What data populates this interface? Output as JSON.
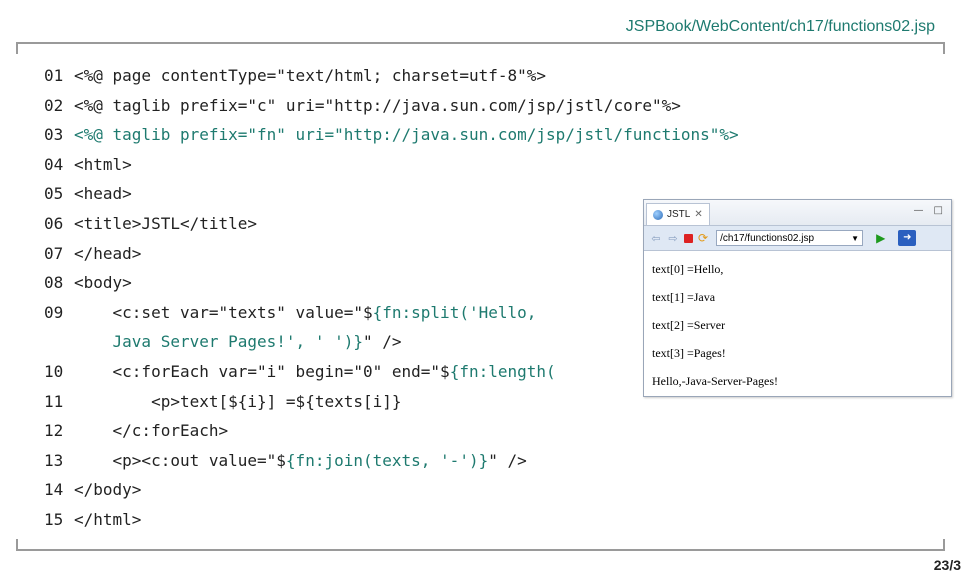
{
  "header": {
    "file_path": "JSPBook/WebContent/ch17/functions02.jsp"
  },
  "code_lines": [
    {
      "num": "01",
      "parts": [
        {
          "text": "<%@ page contentType=\"text/html; charset=utf-8\"%>",
          "teal": false
        }
      ]
    },
    {
      "num": "02",
      "parts": [
        {
          "text": "<%@ taglib prefix=\"c\" uri=\"http://java.sun.com/jsp/jstl/core\"%>",
          "teal": false
        }
      ]
    },
    {
      "num": "03",
      "parts": [
        {
          "text": "<%@ taglib prefix=\"fn\" uri=\"http://java.sun.com/jsp/jstl/functions\"%>",
          "teal": true
        }
      ]
    },
    {
      "num": "04",
      "parts": [
        {
          "text": "<html>",
          "teal": false
        }
      ]
    },
    {
      "num": "05",
      "parts": [
        {
          "text": "<head>",
          "teal": false
        }
      ]
    },
    {
      "num": "06",
      "parts": [
        {
          "text": "<title>JSTL</title>",
          "teal": false
        }
      ]
    },
    {
      "num": "07",
      "parts": [
        {
          "text": "</head>",
          "teal": false
        }
      ]
    },
    {
      "num": "08",
      "parts": [
        {
          "text": "<body>",
          "teal": false
        }
      ]
    },
    {
      "num": "09",
      "parts": [
        {
          "text": "    <c:set var=\"texts\" value=\"$",
          "teal": false
        },
        {
          "text": "{fn:split('Hello,",
          "teal": true
        }
      ]
    },
    {
      "num": "",
      "parts": [
        {
          "text": "    Java Server Pages!', ' ')}",
          "teal": true
        },
        {
          "text": "\" />",
          "teal": false
        }
      ]
    },
    {
      "num": "10",
      "parts": [
        {
          "text": "    <c:forEach var=\"i\" begin=\"0\" end=\"$",
          "teal": false
        },
        {
          "text": "{fn:length(",
          "teal": true
        }
      ]
    },
    {
      "num": "11",
      "parts": [
        {
          "text": "        <p>text[${i}] =${texts[i]}",
          "teal": false
        }
      ]
    },
    {
      "num": "12",
      "parts": [
        {
          "text": "    </c:forEach>",
          "teal": false
        }
      ]
    },
    {
      "num": "13",
      "parts": [
        {
          "text": "    <p><c:out value=\"$",
          "teal": false
        },
        {
          "text": "{fn:join(texts, '-')}",
          "teal": true
        },
        {
          "text": "\" />",
          "teal": false
        }
      ]
    },
    {
      "num": "14",
      "parts": [
        {
          "text": "</body>",
          "teal": false
        }
      ]
    },
    {
      "num": "15",
      "parts": [
        {
          "text": "</html>",
          "teal": false
        }
      ]
    }
  ],
  "browser": {
    "tab_label": "JSTL",
    "tab_close": "✕",
    "url": "/ch17/functions02.jsp",
    "outputs": [
      "text[0] =Hello,",
      "text[1] =Java",
      "text[2] =Server",
      "text[3] =Pages!",
      "Hello,-Java-Server-Pages!"
    ]
  },
  "page_number": "23/3",
  "colors": {
    "accent": "#1e7a6f",
    "frame": "#9a9a9a"
  },
  "icons": {
    "tab": "globe-icon",
    "back": "back-arrow-icon",
    "forward": "forward-arrow-icon",
    "stop": "stop-icon",
    "refresh": "refresh-icon",
    "go": "go-icon",
    "external": "external-browser-icon"
  }
}
